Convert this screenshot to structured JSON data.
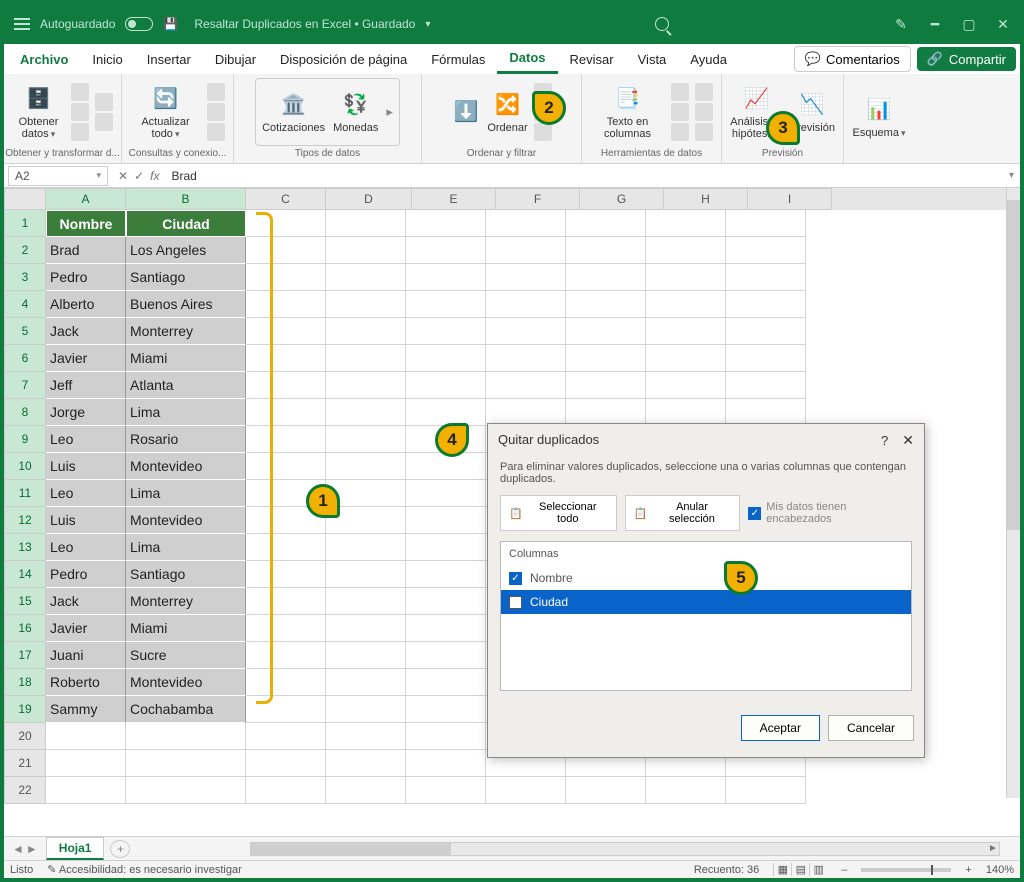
{
  "window": {
    "autosave": "Autoguardado",
    "title": "Resaltar Duplicados en Excel • Guardado"
  },
  "tabs": {
    "file": "Archivo",
    "home": "Inicio",
    "insert": "Insertar",
    "draw": "Dibujar",
    "layout": "Disposición de página",
    "formulas": "Fórmulas",
    "data": "Datos",
    "review": "Revisar",
    "view": "Vista",
    "help": "Ayuda",
    "comments": "Comentarios",
    "share": "Compartir"
  },
  "ribbon": {
    "getdata": "Obtener datos",
    "refresh": "Actualizar todo",
    "group1": "Obtener y transformar d...",
    "group2": "Consultas y conexio...",
    "stocks": "Cotizaciones",
    "currency": "Monedas",
    "group3": "Tipos de datos",
    "sort": "Ordenar",
    "group4": "Ordenar y filtrar",
    "texttocols": "Texto en columnas",
    "group5": "Herramientas de datos",
    "whatif": "Análisis de hipótesis",
    "forecast": "Previsión",
    "group6": "Previsión",
    "outline": "Esquema",
    "group7": ""
  },
  "formula": {
    "namebox": "A2",
    "value": "Brad"
  },
  "cols": {
    "A": "A",
    "B": "B",
    "C": "C",
    "D": "D",
    "E": "E",
    "F": "F",
    "G": "G",
    "H": "H",
    "I": "I"
  },
  "headers": {
    "name": "Nombre",
    "city": "Ciudad"
  },
  "rows": [
    {
      "n": "Brad",
      "c": "Los Angeles"
    },
    {
      "n": "Pedro",
      "c": "Santiago"
    },
    {
      "n": "Alberto",
      "c": "Buenos Aires"
    },
    {
      "n": "Jack",
      "c": "Monterrey"
    },
    {
      "n": "Javier",
      "c": "Miami"
    },
    {
      "n": "Jeff",
      "c": "Atlanta"
    },
    {
      "n": "Jorge",
      "c": "Lima"
    },
    {
      "n": "Leo",
      "c": "Rosario"
    },
    {
      "n": "Luis",
      "c": "Montevideo"
    },
    {
      "n": "Leo",
      "c": "Lima"
    },
    {
      "n": "Luis",
      "c": "Montevideo"
    },
    {
      "n": "Leo",
      "c": "Lima"
    },
    {
      "n": "Pedro",
      "c": "Santiago"
    },
    {
      "n": "Jack",
      "c": "Monterrey"
    },
    {
      "n": "Javier",
      "c": "Miami"
    },
    {
      "n": "Juani",
      "c": "Sucre"
    },
    {
      "n": "Roberto",
      "c": "Montevideo"
    },
    {
      "n": "Sammy",
      "c": "Cochabamba"
    }
  ],
  "dialog": {
    "title": "Quitar duplicados",
    "desc": "Para eliminar valores duplicados, seleccione una o varias columnas que contengan duplicados.",
    "select_all": "Seleccionar todo",
    "unselect_all": "Anular selección",
    "has_headers": "Mis datos tienen encabezados",
    "cols_label": "Columnas",
    "col_name": "Nombre",
    "col_city": "Ciudad",
    "ok": "Aceptar",
    "cancel": "Cancelar"
  },
  "callouts": {
    "c1": "1",
    "c2": "2",
    "c3": "3",
    "c4": "4",
    "c5": "5"
  },
  "sheet": {
    "name": "Hoja1"
  },
  "status": {
    "ready": "Listo",
    "access": "Accesibilidad: es necesario investigar",
    "count": "Recuento: 36",
    "zoom": "140%"
  }
}
